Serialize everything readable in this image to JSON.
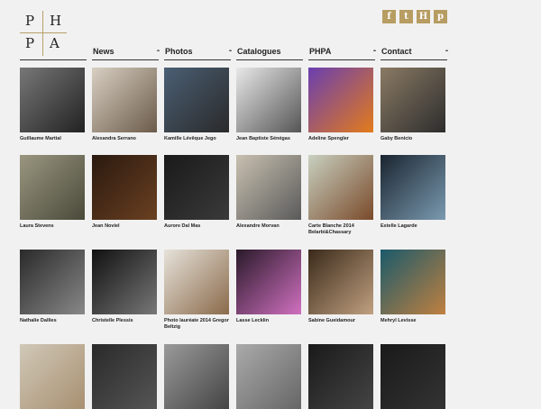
{
  "logo": {
    "letters": [
      "P",
      "H",
      "P",
      "A"
    ]
  },
  "social": [
    {
      "icon": "facebook-icon",
      "glyph": "f"
    },
    {
      "icon": "twitter-icon",
      "glyph": "t"
    },
    {
      "icon": "h-icon",
      "glyph": "H"
    },
    {
      "icon": "pinterest-icon",
      "glyph": "p"
    }
  ],
  "nav": [
    {
      "label": "News",
      "dots": "▪▪"
    },
    {
      "label": "Photos",
      "dots": "▪▪"
    },
    {
      "label": "Catalogues",
      "dots": ""
    },
    {
      "label": "PHPA",
      "dots": "▪▪"
    },
    {
      "label": "Contact",
      "dots": "▪▪"
    }
  ],
  "colors": {
    "accent": "#b79d62",
    "text": "#222222",
    "background": "#f1f1f1"
  },
  "photographers": [
    {
      "name": "Guillaume Martial",
      "tone": [
        "#777",
        "#222"
      ]
    },
    {
      "name": "Alexandra Serrano",
      "tone": [
        "#d8cfc2",
        "#6b5b4a"
      ]
    },
    {
      "name": "Kamille Lévêque Jego",
      "tone": [
        "#4a5f74",
        "#2a2a2a"
      ]
    },
    {
      "name": "Jean Baptiste Sénégas",
      "tone": [
        "#e8e8e8",
        "#555"
      ]
    },
    {
      "name": "Adeline Spengler",
      "tone": [
        "#6a3fb0",
        "#e37b1b"
      ]
    },
    {
      "name": "Gaby Benicio",
      "tone": [
        "#8a7a64",
        "#2d2d2d"
      ]
    },
    {
      "name": "Laura Stevens",
      "tone": [
        "#9a9680",
        "#4a4a3a"
      ]
    },
    {
      "name": "Jean Noviel",
      "tone": [
        "#2a1a10",
        "#6a4020"
      ]
    },
    {
      "name": "Aurore Dal Mas",
      "tone": [
        "#1a1a1a",
        "#3a3a3a"
      ]
    },
    {
      "name": "Alexandre Morvan",
      "tone": [
        "#c8c0b0",
        "#5a5a5a"
      ]
    },
    {
      "name": "Carte Blanche 2014 Belarbi&Chassary",
      "tone": [
        "#c8d0c0",
        "#7a4a2a"
      ]
    },
    {
      "name": "Estelle Lagarde",
      "tone": [
        "#1a2530",
        "#7a9ab0"
      ]
    },
    {
      "name": "Nathalie Dallies",
      "tone": [
        "#2a2a2a",
        "#888"
      ]
    },
    {
      "name": "Christelle Plessis",
      "tone": [
        "#111",
        "#777"
      ]
    },
    {
      "name": "Photo lauréate 2014 Gregor Beltzig",
      "tone": [
        "#e6e2da",
        "#8a6a4a"
      ]
    },
    {
      "name": "Lasse Lecklin",
      "tone": [
        "#2a1a2a",
        "#d070c0"
      ]
    },
    {
      "name": "Sabine Gueidamour",
      "tone": [
        "#3a2a1a",
        "#c0a080"
      ]
    },
    {
      "name": "Mehryl Levisse",
      "tone": [
        "#1a5a6a",
        "#c08040"
      ]
    },
    {
      "name": "",
      "tone": [
        "#d0c8b8",
        "#a89070"
      ]
    },
    {
      "name": "",
      "tone": [
        "#2a2a2a",
        "#555"
      ]
    },
    {
      "name": "",
      "tone": [
        "#9a9a9a",
        "#444"
      ]
    },
    {
      "name": "",
      "tone": [
        "#aaa",
        "#666"
      ]
    },
    {
      "name": "",
      "tone": [
        "#1a1a1a",
        "#444"
      ]
    },
    {
      "name": "",
      "tone": [
        "#1a1a1a",
        "#333"
      ]
    }
  ]
}
